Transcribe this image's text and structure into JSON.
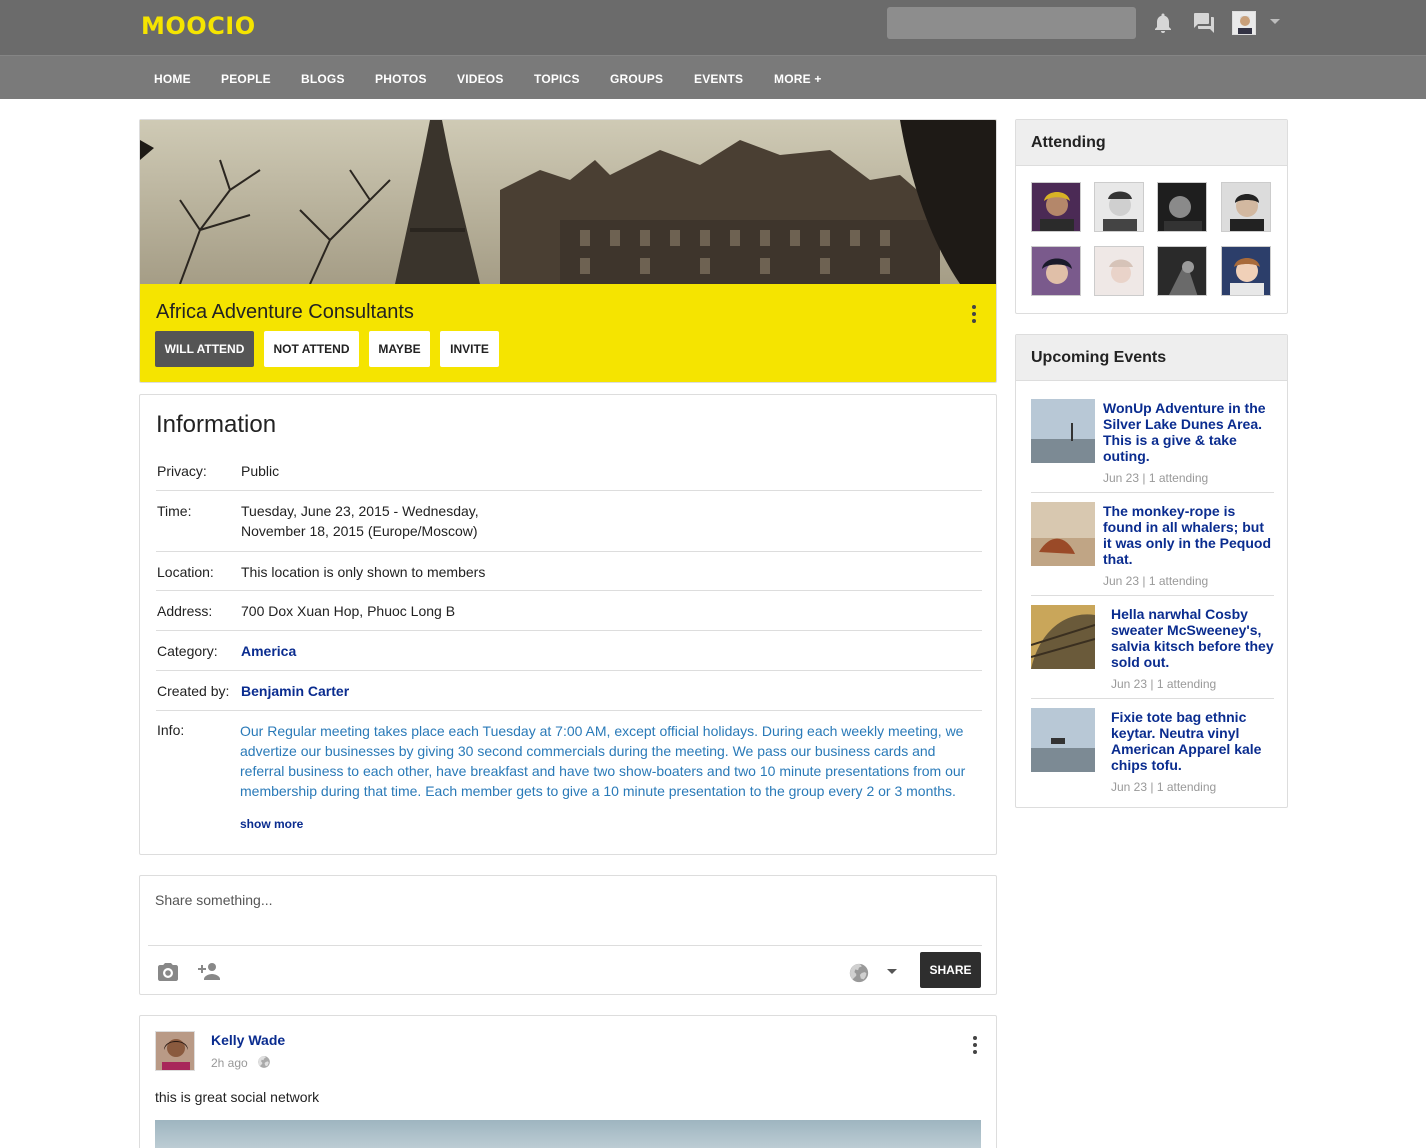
{
  "app": {
    "logo": "MOOCIO"
  },
  "nav": {
    "items": [
      "HOME",
      "PEOPLE",
      "BLOGS",
      "PHOTOS",
      "VIDEOS",
      "TOPICS",
      "GROUPS",
      "EVENTS",
      "MORE +"
    ]
  },
  "event": {
    "title": "Africa Adventure Consultants",
    "buttons": {
      "will_attend": "WILL ATTEND",
      "not_attend": "NOT ATTEND",
      "maybe": "MAYBE",
      "invite": "INVITE"
    }
  },
  "info": {
    "heading": "Information",
    "rows": [
      {
        "label": "Privacy:",
        "value": "Public"
      },
      {
        "label": "Time:",
        "value": "Tuesday, June 23, 2015 - Wednesday,",
        "value2": "November 18, 2015 (Europe/Moscow)"
      },
      {
        "label": "Location:",
        "value": "This location is only shown to members"
      },
      {
        "label": "Address:",
        "value": "700 Dox Xuan Hop, Phuoc Long B"
      },
      {
        "label": "Category:",
        "value": "America"
      },
      {
        "label": "Created by:",
        "value": "Benjamin Carter"
      },
      {
        "label": "Info:",
        "value": "Our Regular meeting takes place each Tuesday at 7:00 AM, except official holidays. During each weekly meeting, we advertize our businesses by giving 30 second commercials during the meeting. We pass our business cards and referral business to each other, have breakfast and have two show-boaters and two 10 minute presentations from our membership during that time. Each member gets to give a 10 minute presentation to the group every 2 or 3 months."
      }
    ],
    "show_more": "show more"
  },
  "share": {
    "placeholder": "Share something...",
    "button": "SHARE"
  },
  "post": {
    "author": "Kelly Wade",
    "time": "2h ago",
    "text": "this is great social network"
  },
  "sidebar": {
    "attending": {
      "title": "Attending"
    },
    "upcoming": {
      "title": "Upcoming Events",
      "events": [
        {
          "title": "WonUp Adventure in the Silver Lake Dunes Area. This is a give & take outing.",
          "meta": "Jun 23 | 1 attending"
        },
        {
          "title": "The monkey-rope is found in all whalers; but it was only in the Pequod that.",
          "meta": "Jun 23 | 1 attending"
        },
        {
          "title": "Hella narwhal Cosby sweater McSweeney's, salvia kitsch before they sold out.",
          "meta": "Jun 23 | 1 attending"
        },
        {
          "title": "Fixie tote bag ethnic keytar. Neutra vinyl American Apparel kale chips tofu.",
          "meta": "Jun 23 | 1 attending"
        }
      ]
    }
  },
  "colors": {
    "accent": "#f5e400",
    "link": "#0a2c8f",
    "topbar": "#6b6b6b",
    "navbar": "#7a7a7a"
  },
  "icons": [
    "bell-icon",
    "chat-icon",
    "camera-icon",
    "add-person-icon",
    "globe-icon",
    "kebab-menu-icon"
  ]
}
